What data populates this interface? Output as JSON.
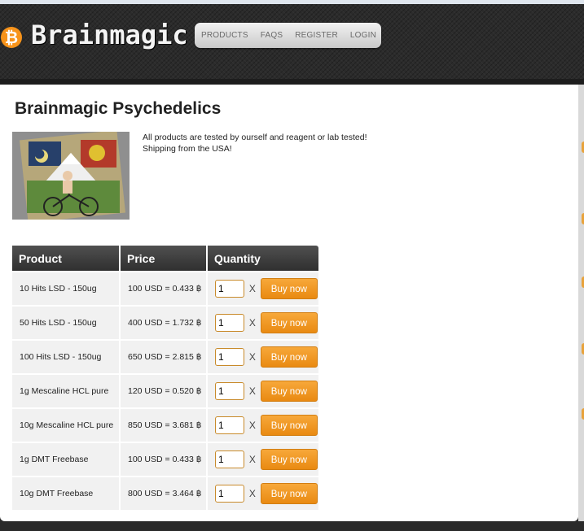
{
  "brand": {
    "name": "Brainmagic",
    "coin_color": "#f7931a"
  },
  "nav": {
    "items": [
      {
        "label": "PRODUCTS"
      },
      {
        "label": "FAQS"
      },
      {
        "label": "REGISTER"
      },
      {
        "label": "LOGIN"
      }
    ]
  },
  "page": {
    "title": "Brainmagic Psychedelics",
    "intro_lines": [
      "All products are tested by ourself and reagent or lab tested!",
      "Shipping from the USA!"
    ]
  },
  "table": {
    "headers": [
      "Product",
      "Price",
      "Quantity"
    ],
    "buy_label": "Buy now",
    "qty_separator": "X",
    "rows": [
      {
        "product": "10 Hits LSD - 150ug",
        "price": "100 USD = 0.433 ฿",
        "qty": "1"
      },
      {
        "product": "50 Hits LSD - 150ug",
        "price": "400 USD = 1.732 ฿",
        "qty": "1"
      },
      {
        "product": "100 Hits LSD - 150ug",
        "price": "650 USD = 2.815 ฿",
        "qty": "1"
      },
      {
        "product": "1g Mescaline HCL pure",
        "price": "120 USD = 0.520 ฿",
        "qty": "1"
      },
      {
        "product": "10g Mescaline HCL pure",
        "price": "850 USD = 3.681 ฿",
        "qty": "1"
      },
      {
        "product": "1g DMT Freebase",
        "price": "100 USD = 0.433 ฿",
        "qty": "1"
      },
      {
        "product": "10g DMT Freebase",
        "price": "800 USD = 3.464 ฿",
        "qty": "1"
      }
    ]
  },
  "colors": {
    "accent": "#ee9a22",
    "header_bg": "#2b2b2b"
  }
}
